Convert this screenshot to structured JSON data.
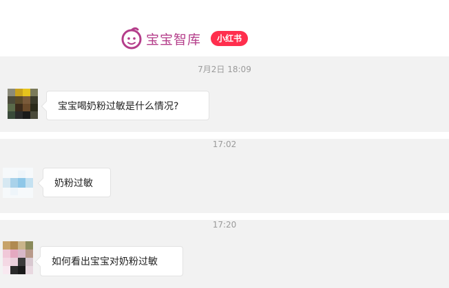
{
  "header": {
    "brand_name": "宝宝智库",
    "badge": "小红书",
    "logo_icon": "baby-face-logo-icon",
    "brand_color": "#b43d8a",
    "badge_color": "#ff2e4d"
  },
  "messages": [
    {
      "time": "7月2日 18:09",
      "text": "宝宝喝奶粉过敏是什么情况?"
    },
    {
      "time": "17:02",
      "text": "奶粉过敏"
    },
    {
      "time": "17:20",
      "text": "如何看出宝宝对奶粉过敏"
    }
  ]
}
